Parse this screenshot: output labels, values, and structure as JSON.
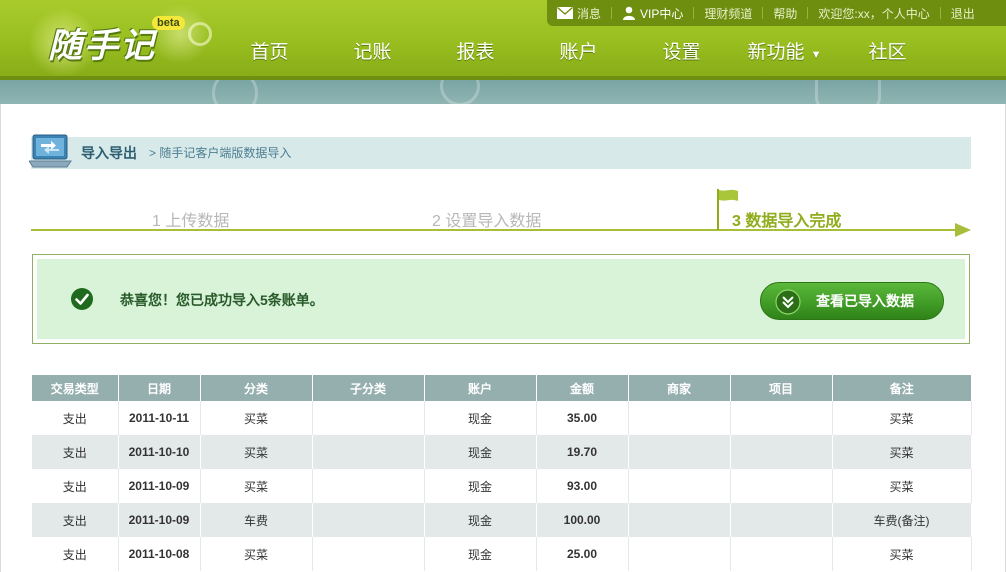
{
  "header": {
    "logo_text": "随手记",
    "beta": "beta",
    "topbar": {
      "messages": "消息",
      "vip": "VIP中心",
      "finance": "理财频道",
      "help": "帮助",
      "welcome": "欢迎您:xx，个人中心",
      "logout": "退出"
    },
    "nav": [
      "首页",
      "记账",
      "报表",
      "账户",
      "设置",
      "新功能",
      "社区"
    ]
  },
  "breadcrumb": {
    "title": "导入导出",
    "sub": "> 随手记客户端版数据导入"
  },
  "steps": [
    {
      "label": "1 上传数据",
      "active": false
    },
    {
      "label": "2 设置导入数据",
      "active": false
    },
    {
      "label": "3 数据导入完成",
      "active": true
    }
  ],
  "success": {
    "prefix": "恭喜您！您已成功导入",
    "count": "5",
    "suffix": "条账单。",
    "button": "查看已导入数据"
  },
  "table": {
    "columns": [
      "交易类型",
      "日期",
      "分类",
      "子分类",
      "账户",
      "金额",
      "商家",
      "项目",
      "备注"
    ],
    "rows": [
      [
        "支出",
        "2011-10-11",
        "买菜",
        "",
        "现金",
        "35.00",
        "",
        "",
        "买菜"
      ],
      [
        "支出",
        "2011-10-10",
        "买菜",
        "",
        "现金",
        "19.70",
        "",
        "",
        "买菜"
      ],
      [
        "支出",
        "2011-10-09",
        "买菜",
        "",
        "现金",
        "93.00",
        "",
        "",
        "买菜"
      ],
      [
        "支出",
        "2011-10-09",
        "车费",
        "",
        "现金",
        "100.00",
        "",
        "",
        "车费(备注)"
      ],
      [
        "支出",
        "2011-10-08",
        "买菜",
        "",
        "现金",
        "25.00",
        "",
        "",
        "买菜"
      ]
    ]
  },
  "colors": {
    "brand_green": "#97bd1f",
    "table_header": "#95aeae",
    "success_bg": "#d8f3d8"
  }
}
